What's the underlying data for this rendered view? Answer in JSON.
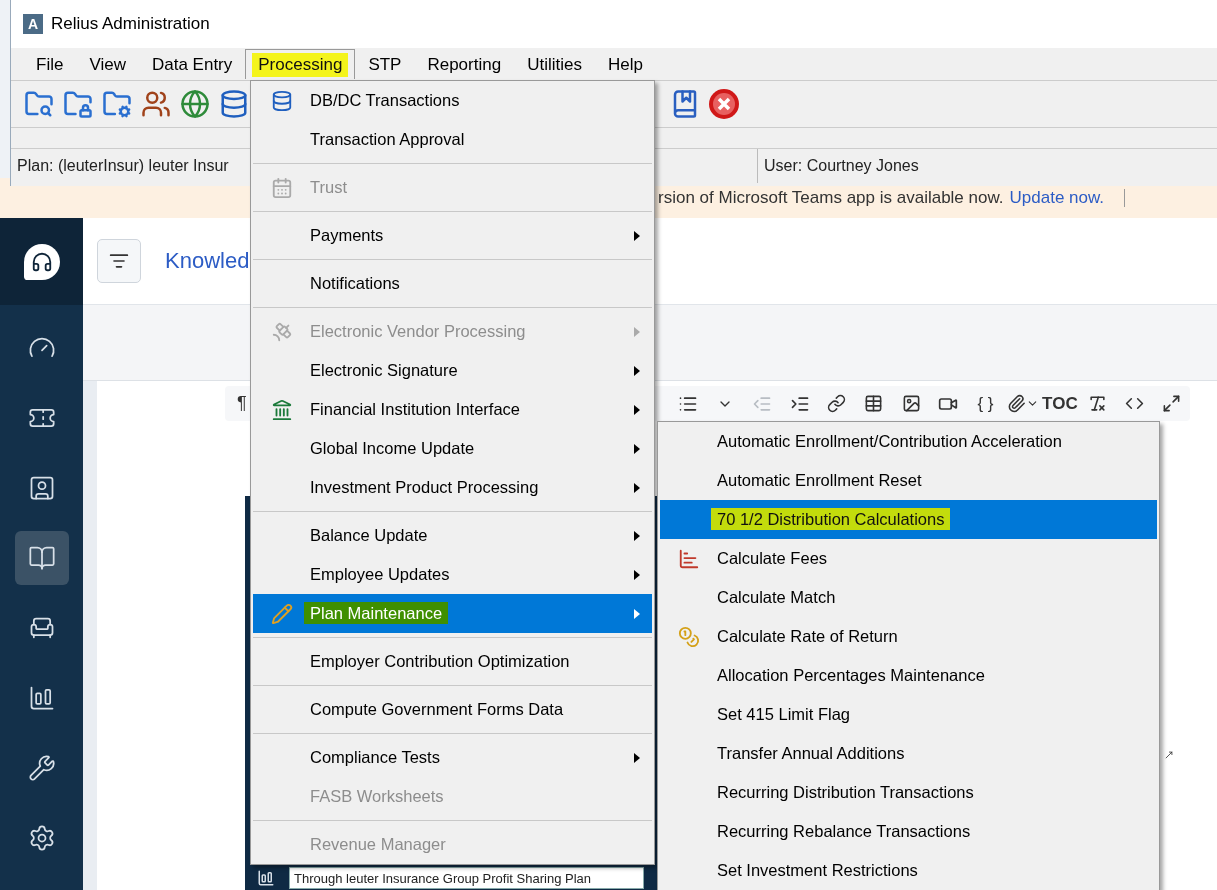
{
  "window": {
    "title": "Relius Administration",
    "logo": "A"
  },
  "menu_bar": [
    {
      "label": "File",
      "selected": false
    },
    {
      "label": "View",
      "selected": false
    },
    {
      "label": "Data Entry",
      "selected": false
    },
    {
      "label": "Processing",
      "selected": true,
      "color": "#f4f41c"
    },
    {
      "label": "STP",
      "selected": false
    },
    {
      "label": "Reporting",
      "selected": false
    },
    {
      "label": "Utilities",
      "selected": false
    },
    {
      "label": "Help",
      "selected": false
    }
  ],
  "status_bar": {
    "plan": "Plan: (leuterInsur) leuter Insur",
    "user": "User: Courtney Jones"
  },
  "processing_menu": [
    {
      "kind": "item",
      "label": "DB/DC Transactions",
      "disabled": false,
      "submenu": false,
      "selected": false
    },
    {
      "kind": "item",
      "label": "Transaction Approval",
      "disabled": false,
      "submenu": false,
      "selected": false
    },
    {
      "kind": "separator"
    },
    {
      "kind": "item",
      "label": "Trust",
      "disabled": true,
      "submenu": false,
      "selected": false
    },
    {
      "kind": "separator"
    },
    {
      "kind": "item",
      "label": "Payments",
      "disabled": false,
      "submenu": true,
      "selected": false
    },
    {
      "kind": "separator"
    },
    {
      "kind": "item",
      "label": "Notifications",
      "disabled": false,
      "submenu": false,
      "selected": false
    },
    {
      "kind": "separator"
    },
    {
      "kind": "item",
      "label": "Electronic Vendor Processing",
      "disabled": true,
      "submenu": true,
      "selected": false
    },
    {
      "kind": "item",
      "label": "Electronic Signature",
      "disabled": false,
      "submenu": true,
      "selected": false
    },
    {
      "kind": "item",
      "label": "Financial Institution Interface",
      "disabled": false,
      "submenu": true,
      "selected": false
    },
    {
      "kind": "item",
      "label": "Global Income Update",
      "disabled": false,
      "submenu": true,
      "selected": false
    },
    {
      "kind": "item",
      "label": "Investment Product Processing",
      "disabled": false,
      "submenu": true,
      "selected": false
    },
    {
      "kind": "separator"
    },
    {
      "kind": "item",
      "label": "Balance Update",
      "disabled": false,
      "submenu": true,
      "selected": false
    },
    {
      "kind": "item",
      "label": "Employee Updates",
      "disabled": false,
      "submenu": true,
      "selected": false
    },
    {
      "kind": "item",
      "label": "Plan Maintenance",
      "disabled": false,
      "submenu": true,
      "selected": true,
      "color": "#3f8f00"
    },
    {
      "kind": "separator"
    },
    {
      "kind": "item",
      "label": "Employer Contribution Optimization",
      "disabled": false,
      "submenu": false,
      "selected": false
    },
    {
      "kind": "separator"
    },
    {
      "kind": "item",
      "label": "Compute Government Forms Data",
      "disabled": false,
      "submenu": false,
      "selected": false
    },
    {
      "kind": "separator"
    },
    {
      "kind": "item",
      "label": "Compliance Tests",
      "disabled": false,
      "submenu": true,
      "selected": false
    },
    {
      "kind": "item",
      "label": "FASB Worksheets",
      "disabled": true,
      "submenu": false,
      "selected": false
    },
    {
      "kind": "separator"
    },
    {
      "kind": "item",
      "label": "Revenue Manager",
      "disabled": true,
      "submenu": false,
      "selected": false
    }
  ],
  "plan_maintenance_submenu": [
    {
      "label": "Automatic Enrollment/Contribution Acceleration",
      "selected": false
    },
    {
      "label": "Automatic Enrollment Reset",
      "selected": false
    },
    {
      "label": "70 1/2 Distribution Calculations",
      "selected": true,
      "color": "#c3dc0c"
    },
    {
      "label": "Calculate Fees",
      "selected": false
    },
    {
      "label": "Calculate Match",
      "selected": false
    },
    {
      "label": "Calculate Rate of Return",
      "selected": false
    },
    {
      "label": "Allocation Percentages Maintenance",
      "selected": false
    },
    {
      "label": "Set 415 Limit Flag",
      "selected": false
    },
    {
      "label": "Transfer Annual Additions",
      "selected": false
    },
    {
      "label": "Recurring Distribution Transactions",
      "selected": false
    },
    {
      "label": "Recurring Rebalance Transactions",
      "selected": false
    },
    {
      "label": "Set Investment Restrictions",
      "selected": false
    }
  ],
  "banner": {
    "text": "rsion of Microsoft Teams app is available now.",
    "link": "Update now."
  },
  "sidebar": {
    "items": [
      {
        "selected": false
      },
      {
        "selected": false
      },
      {
        "selected": false
      },
      {
        "selected": true
      },
      {
        "selected": false
      },
      {
        "selected": false
      },
      {
        "selected": false
      },
      {
        "selected": false
      }
    ]
  },
  "header": {
    "title": "Knowled"
  },
  "editor_toolbar": {
    "paragraph": "¶",
    "braces": "{ }",
    "toc": "TOC",
    "outdent_disabled": true
  },
  "bottom_field": {
    "value": "Through leuter Insurance Group Profit Sharing Plan"
  }
}
